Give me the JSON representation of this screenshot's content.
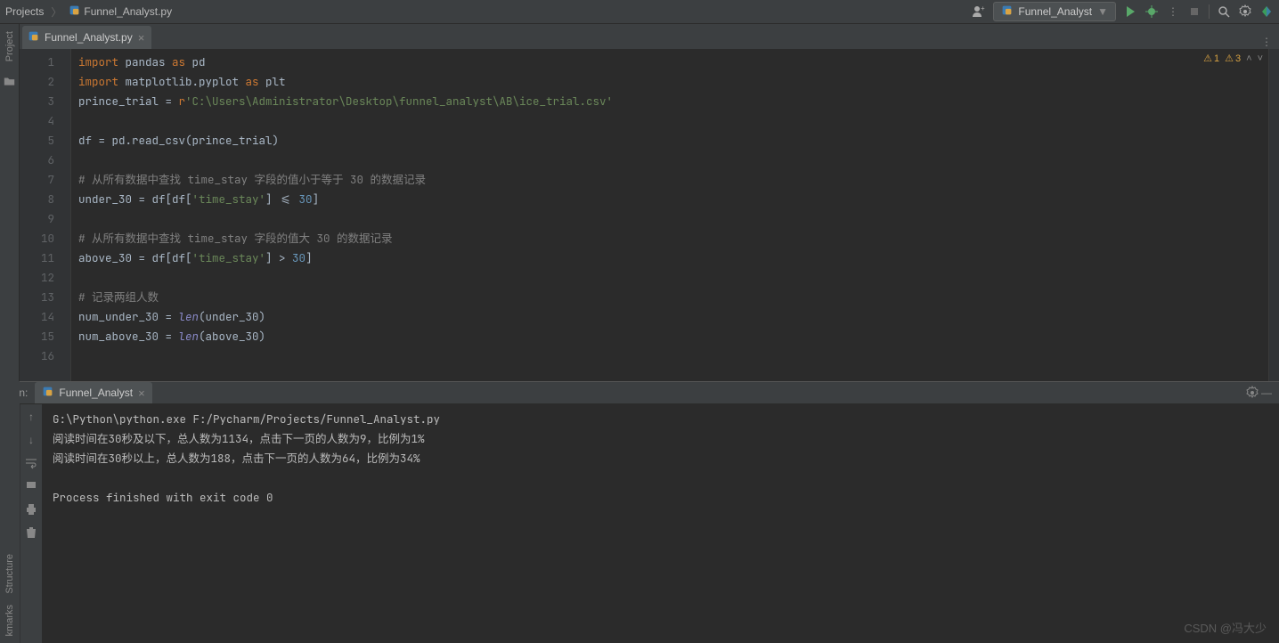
{
  "nav": {
    "breadcrumb": [
      "Projects",
      "Funnel_Analyst.py"
    ],
    "run_config": "Funnel_Analyst"
  },
  "tabs": {
    "open": [
      {
        "name": "Funnel_Analyst.py",
        "active": true
      }
    ]
  },
  "editor": {
    "lines": [
      {
        "n": 1,
        "html": "<span class='kw'>import</span> pandas <span class='kw'>as</span> pd"
      },
      {
        "n": 2,
        "html": "<span class='kw'>import</span> matplotlib.pyplot <span class='kw'>as</span> plt"
      },
      {
        "n": 3,
        "html": "prince_trial = <span class='kw'>r</span><span class='str'>'C:\\Users\\Administrator\\Desktop\\funnel_analyst\\AB\\ice_trial.csv'</span>"
      },
      {
        "n": 4,
        "html": ""
      },
      {
        "n": 5,
        "html": "df = pd.read_csv(prince_trial)"
      },
      {
        "n": 6,
        "html": ""
      },
      {
        "n": 7,
        "html": "<span class='cmt'># 从所有数据中查找 time_stay 字段的值小于等于 30 的数据记录</span>"
      },
      {
        "n": 8,
        "html": "under_30 = df[df[<span class='str'>'time_stay'</span>] &lt;= <span class='num'>30</span>]"
      },
      {
        "n": 9,
        "html": ""
      },
      {
        "n": 10,
        "html": "<span class='cmt'># 从所有数据中查找 time_stay 字段的值大 30 的数据记录</span>"
      },
      {
        "n": 11,
        "html": "above_30 = df[df[<span class='str'>'time_stay'</span>] &gt; <span class='num'>30</span>]"
      },
      {
        "n": 12,
        "html": ""
      },
      {
        "n": 13,
        "html": "<span class='cmt'># 记录两组人数</span>"
      },
      {
        "n": 14,
        "html": "num_under_30 = <span class='fn'>len</span>(under_30)"
      },
      {
        "n": 15,
        "html": "num_above_30 = <span class='fn'>len</span>(above_30)"
      },
      {
        "n": 16,
        "html": ""
      }
    ]
  },
  "inspection": {
    "errors_icon_count": "1",
    "warnings_icon_count": "3"
  },
  "run": {
    "label": "Run:",
    "config_tab": "Funnel_Analyst",
    "output": [
      "G:\\Python\\python.exe F:/Pycharm/Projects/Funnel_Analyst.py",
      "阅读时间在30秒及以下，总人数为1134，点击下一页的人数为9，比例为1%",
      "阅读时间在30秒以上，总人数为188，点击下一页的人数为64，比例为34%",
      "",
      "Process finished with exit code 0"
    ]
  },
  "side_tools": {
    "left_top": [
      "Project"
    ],
    "left_bottom": [
      "Structure",
      "kmarks"
    ]
  },
  "watermark": "CSDN @冯大少"
}
